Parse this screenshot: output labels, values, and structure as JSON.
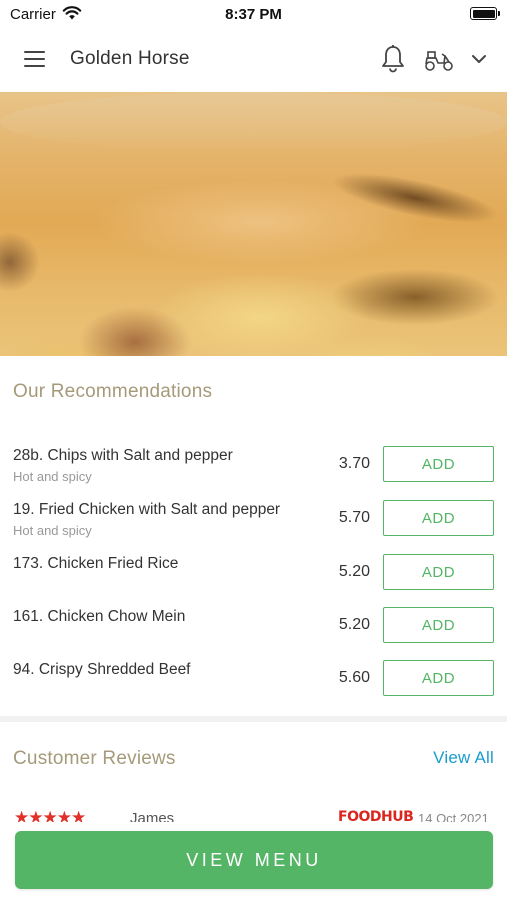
{
  "status_bar": {
    "carrier": "Carrier",
    "time": "8:37 PM"
  },
  "header": {
    "title": "Golden Horse",
    "icons": [
      "menu-icon",
      "bell-icon",
      "scooter-icon",
      "chevron-down-icon"
    ]
  },
  "hero": {
    "image": "food-dish-photo"
  },
  "recommendations": {
    "title": "Our Recommendations",
    "items": [
      {
        "name": "28b. Chips with Salt and pepper",
        "desc": "Hot and spicy",
        "price": "3.70",
        "action": "ADD"
      },
      {
        "name": "19. Fried Chicken with Salt and pepper",
        "desc": "Hot and spicy",
        "price": "5.70",
        "action": "ADD"
      },
      {
        "name": "173. Chicken Fried Rice",
        "desc": "",
        "price": "5.20",
        "action": "ADD"
      },
      {
        "name": "161. Chicken Chow Mein",
        "desc": "",
        "price": "5.20",
        "action": "ADD"
      },
      {
        "name": "94. Crispy Shredded Beef",
        "desc": "",
        "price": "5.60",
        "action": "ADD"
      }
    ]
  },
  "reviews": {
    "title": "Customer Reviews",
    "view_all": "View All",
    "items": [
      {
        "stars": "★★★★★",
        "rating": 5,
        "name": "James",
        "source": "FOODHUB",
        "date": "14 Oct 2021"
      }
    ]
  },
  "footer": {
    "button": "VIEW MENU"
  },
  "colors": {
    "accent_green": "#55b566",
    "section_title": "#a59a79",
    "link_blue": "#1b9ccf",
    "star_red": "#e0312b"
  }
}
